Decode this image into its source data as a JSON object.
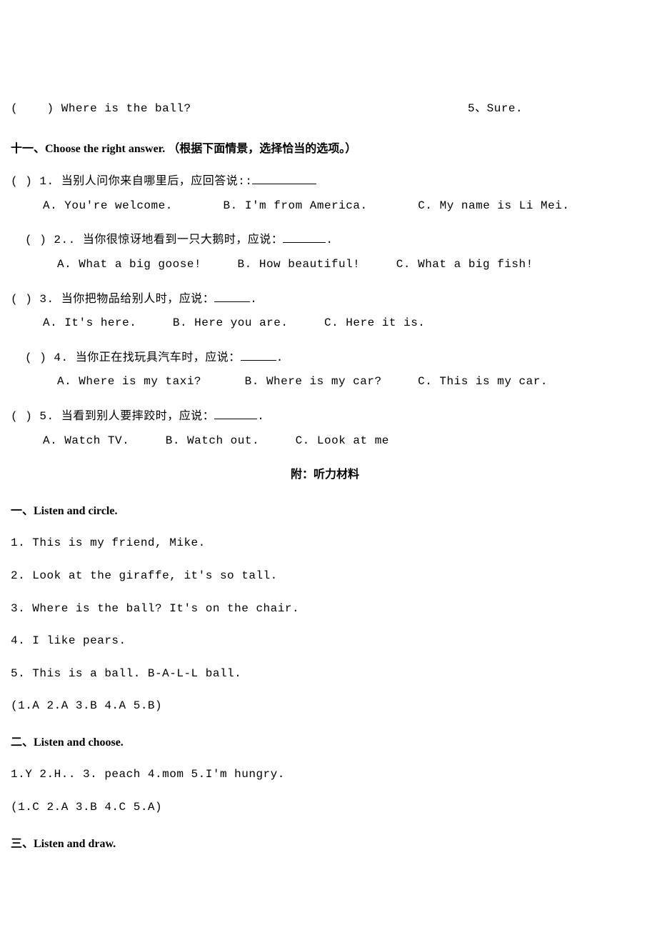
{
  "top": {
    "left_paren_l": "( ",
    "left_paren_r": " )",
    "left_q": "Where is the ball?",
    "right_num": "5、",
    "right_text": "Sure."
  },
  "sec11": {
    "title": "十一、Choose the right answer. （根据下面情景，选择恰当的选项。）",
    "q1": {
      "pre": "(     ) 1. 当别人问你来自哪里后，应回答说::",
      "a": "A. You're welcome.",
      "b": "B. I'm from America.",
      "c": "C. My name is Li Mei."
    },
    "q2": {
      "pre": "(     ) 2.. 当你很惊讶地看到一只大鹅时，应说：",
      "post": ".",
      "a": "A. What a big goose!",
      "b": "B. How beautiful!",
      "c": "C. What a big fish!"
    },
    "q3": {
      "pre": "(     ) 3. 当你把物品给别人时，应说：",
      "post": ".",
      "a": "A. It's here.",
      "b": "B. Here you are.",
      "c": "C. Here it is."
    },
    "q4": {
      "pre": "(     ) 4. 当你正在找玩具汽车时，应说：",
      "post": ".",
      "a": "A. Where is my taxi?",
      "b": "B. Where is my car?",
      "c": "C. This is my car."
    },
    "q5": {
      "pre": "(     ) 5. 当看到别人要摔跤时，应说：",
      "post": ".",
      "a": "A. Watch TV.",
      "b": "B. Watch out.",
      "c": "C. Look at me"
    }
  },
  "appendix_title": "附：听力材料",
  "sec1": {
    "title": "一、Listen and circle.",
    "l1": "1. This is my friend, Mike.",
    "l2": "2. Look at the giraffe, it's so tall.",
    "l3": "3. Where is the ball? It's on the chair.",
    "l4": "4. I like pears.",
    "l5": "5. This is a ball. B-A-L-L ball.",
    "ans": "(1.A   2.A   3.B   4.A   5.B)"
  },
  "sec2": {
    "title": "二、Listen and choose.",
    "l1": "1.Y   2.H.. 3. peach   4.mom   5.I'm hungry.",
    "ans": "(1.C   2.A   3.B   4.C   5.A)"
  },
  "sec3": {
    "title": "三、Listen and draw."
  }
}
